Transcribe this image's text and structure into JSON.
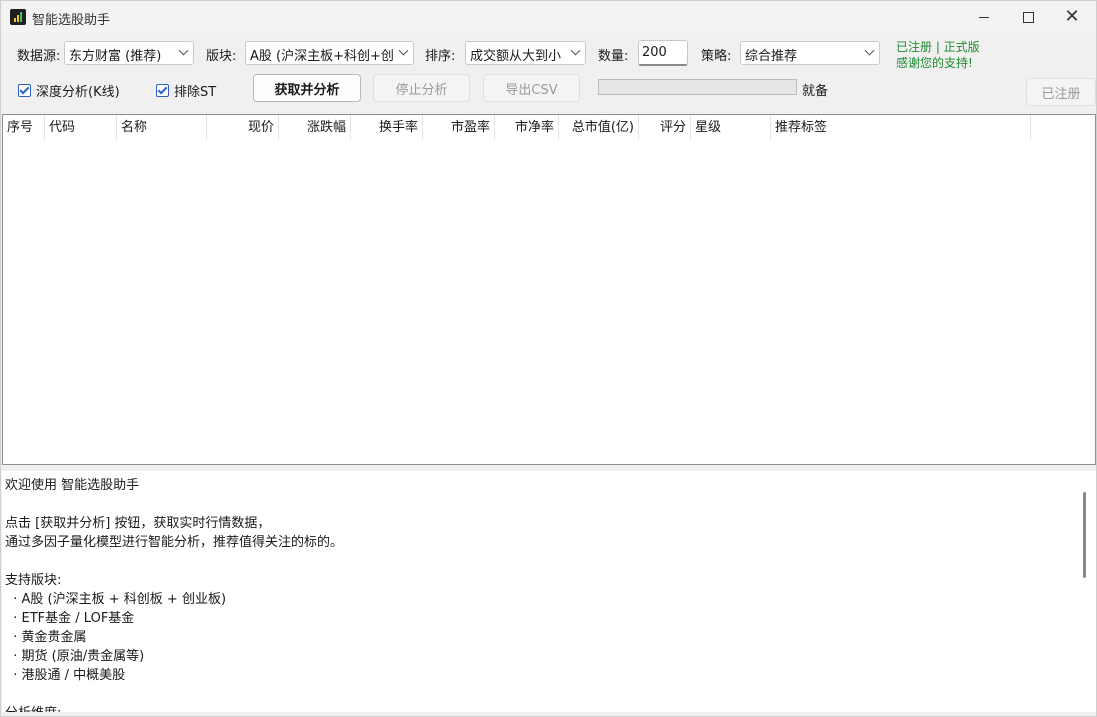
{
  "window": {
    "title": "智能选股助手"
  },
  "controls": {
    "source_label": "数据源:",
    "source_value": "东方财富 (推荐)",
    "sector_label": "版块:",
    "sector_value": "A股 (沪深主板+科创+创",
    "sort_label": "排序:",
    "sort_value": "成交额从大到小",
    "count_label": "数量:",
    "count_value": "200",
    "strategy_label": "策略:",
    "strategy_value": "综合推荐",
    "reg_status": "已注册 | 正式版",
    "reg_thanks": "感谢您的支持!",
    "deep_label": "深度分析(K线)",
    "exclude_st_label": "排除ST",
    "fetch_button": "获取并分析",
    "stop_button": "停止分析",
    "export_button": "导出CSV",
    "progress": 0,
    "status_text": "就备",
    "registered_button": "已注册"
  },
  "table": {
    "columns": [
      "序号",
      "代码",
      "名称",
      "现价",
      "涨跌幅",
      "换手率",
      "市盈率",
      "市净率",
      "总市值(亿)",
      "评分",
      "星级",
      "推荐标签"
    ],
    "rows": []
  },
  "log": {
    "lines": [
      "欢迎使用 智能选股助手",
      "",
      "点击 [获取并分析] 按钮，获取实时行情数据，",
      "通过多因子量化模型进行智能分析，推荐值得关注的标的。",
      "",
      "支持版块:",
      "  · A股 (沪深主板 + 科创板 + 创业板)",
      "  · ETF基金 / LOF基金",
      "  · 黄金贵金属",
      "  · 期货 (原油/贵金属等)",
      "  · 港股通 / 中概美股",
      "",
      "分析维度:"
    ]
  },
  "colors": {
    "accent_green": "#1e8a2e",
    "checkbox_blue": "#2a62c9"
  }
}
